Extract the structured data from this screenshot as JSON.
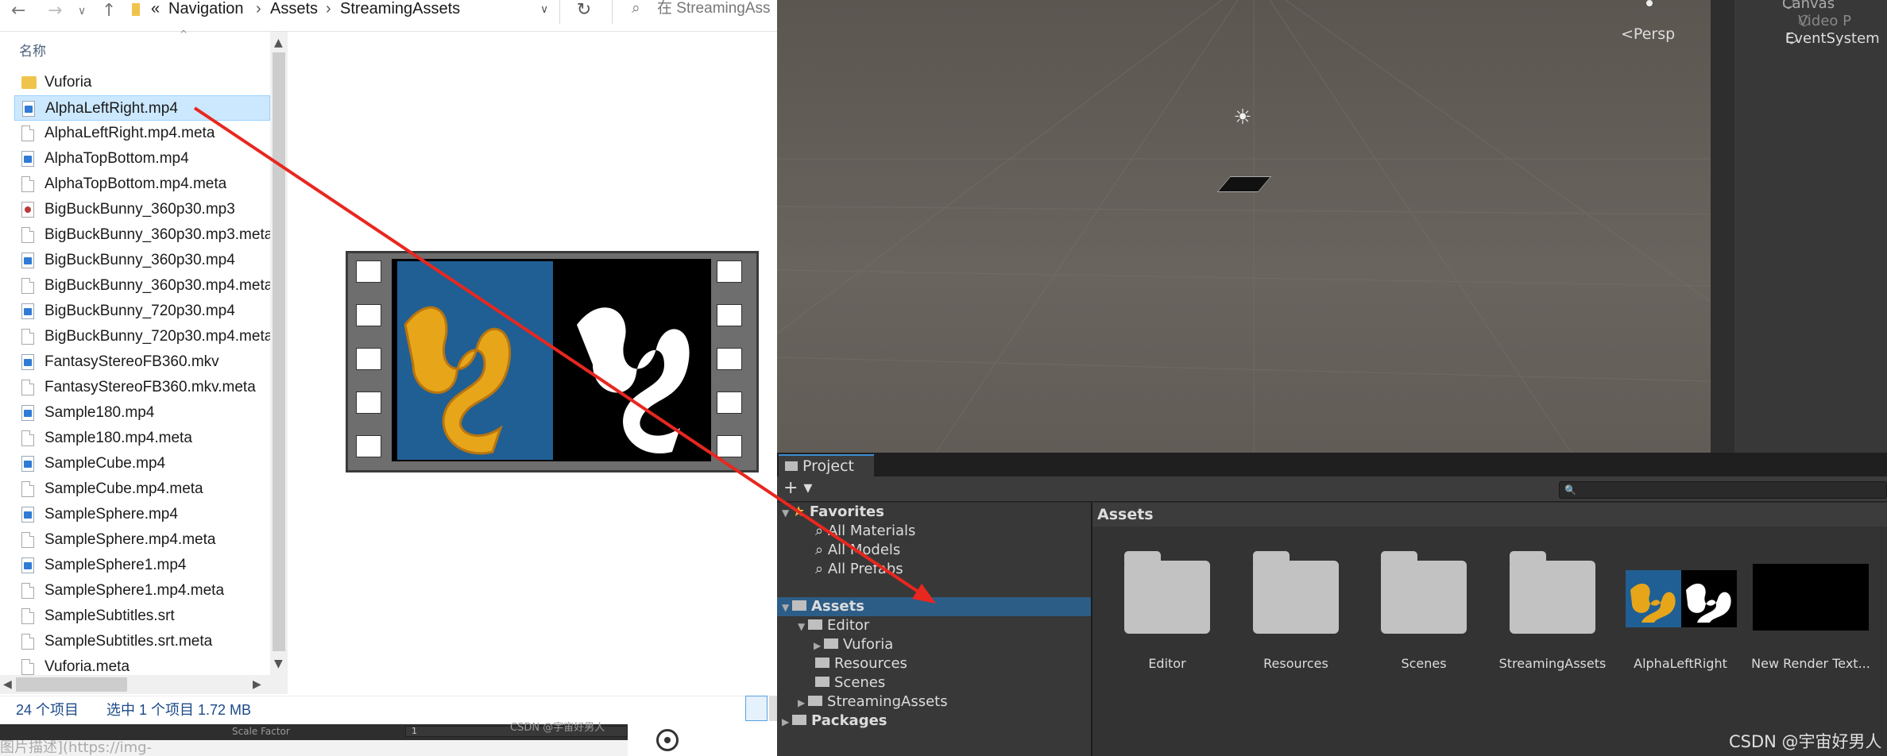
{
  "explorer": {
    "breadcrumb": {
      "prefix": "«",
      "items": [
        "Navigation",
        "Assets",
        "StreamingAssets"
      ]
    },
    "search_placeholder": "在 StreamingAss",
    "column_header": "名称",
    "files": [
      {
        "name": "Vuforia",
        "type": "folder"
      },
      {
        "name": "AlphaLeftRight.mp4",
        "type": "video",
        "selected": true
      },
      {
        "name": "AlphaLeftRight.mp4.meta",
        "type": "doc"
      },
      {
        "name": "AlphaTopBottom.mp4",
        "type": "video"
      },
      {
        "name": "AlphaTopBottom.mp4.meta",
        "type": "doc"
      },
      {
        "name": "BigBuckBunny_360p30.mp3",
        "type": "audio"
      },
      {
        "name": "BigBuckBunny_360p30.mp3.meta",
        "type": "doc"
      },
      {
        "name": "BigBuckBunny_360p30.mp4",
        "type": "video"
      },
      {
        "name": "BigBuckBunny_360p30.mp4.meta",
        "type": "doc"
      },
      {
        "name": "BigBuckBunny_720p30.mp4",
        "type": "video"
      },
      {
        "name": "BigBuckBunny_720p30.mp4.meta",
        "type": "doc"
      },
      {
        "name": "FantasyStereoFB360.mkv",
        "type": "video"
      },
      {
        "name": "FantasyStereoFB360.mkv.meta",
        "type": "doc"
      },
      {
        "name": "Sample180.mp4",
        "type": "video"
      },
      {
        "name": "Sample180.mp4.meta",
        "type": "doc"
      },
      {
        "name": "SampleCube.mp4",
        "type": "video"
      },
      {
        "name": "SampleCube.mp4.meta",
        "type": "doc"
      },
      {
        "name": "SampleSphere.mp4",
        "type": "video"
      },
      {
        "name": "SampleSphere.mp4.meta",
        "type": "doc"
      },
      {
        "name": "SampleSphere1.mp4",
        "type": "video"
      },
      {
        "name": "SampleSphere1.mp4.meta",
        "type": "doc"
      },
      {
        "name": "SampleSubtitles.srt",
        "type": "doc"
      },
      {
        "name": "SampleSubtitles.srt.meta",
        "type": "doc"
      },
      {
        "name": "Vuforia.meta",
        "type": "doc"
      }
    ],
    "status": {
      "count": "24 个项目",
      "selection": "选中 1 个项目  1.72 MB"
    }
  },
  "bottom_strip": {
    "field_label": "Scale Factor",
    "field_value": "1",
    "watermark": "CSDN @宇宙好男人",
    "link_text": "图片描述](https://img-"
  },
  "unity": {
    "scene": {
      "persp_label": "Persp"
    },
    "hierarchy": {
      "items": [
        "Canvas",
        "Video P",
        "EventSystem"
      ]
    },
    "project": {
      "tab_label": "Project",
      "plus": "+ ▾",
      "tree": {
        "favorites": "Favorites",
        "fav_items": [
          "All Materials",
          "All Models",
          "All Prefabs"
        ],
        "assets": "Assets",
        "editor": "Editor",
        "vuforia": "Vuforia",
        "resources": "Resources",
        "scenes": "Scenes",
        "streaming": "StreamingAssets",
        "packages": "Packages"
      },
      "assets_header": "Assets",
      "assets": [
        "Editor",
        "Resources",
        "Scenes",
        "StreamingAssets",
        "AlphaLeftRight",
        "New Render Text..."
      ]
    }
  },
  "watermark": "CSDN @宇宙好男人",
  "colors": {
    "arrow": "#e8271f",
    "selection": "#cce8ff",
    "unity_selection": "#2c5d87"
  }
}
